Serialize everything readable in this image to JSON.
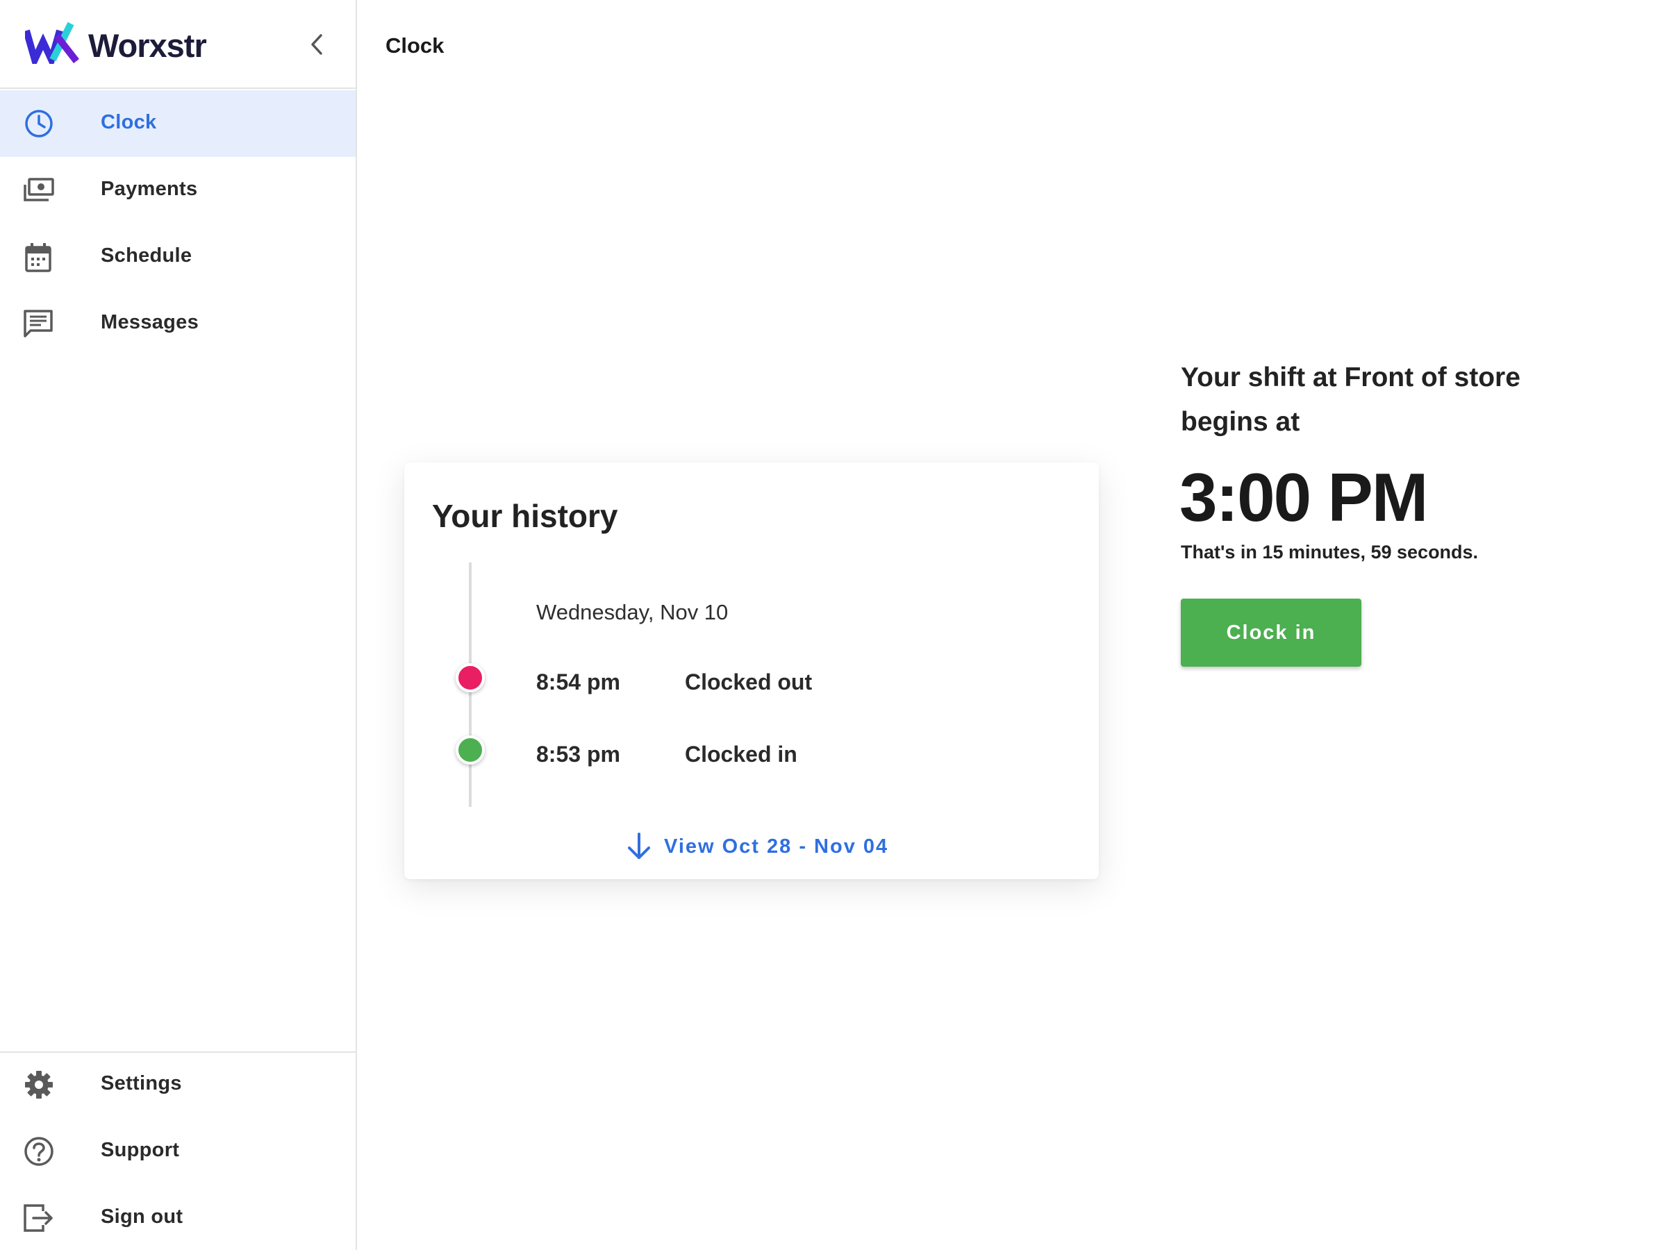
{
  "app": {
    "name": "Worxstr"
  },
  "sidebar": {
    "items": [
      {
        "label": "Clock",
        "icon": "clock-icon",
        "active": true
      },
      {
        "label": "Payments",
        "icon": "payments-icon",
        "active": false
      },
      {
        "label": "Schedule",
        "icon": "calendar-icon",
        "active": false
      },
      {
        "label": "Messages",
        "icon": "message-icon",
        "active": false
      }
    ],
    "bottom_items": [
      {
        "label": "Settings",
        "icon": "gear-icon"
      },
      {
        "label": "Support",
        "icon": "help-icon"
      },
      {
        "label": "Sign out",
        "icon": "sign-out-icon"
      }
    ]
  },
  "header": {
    "title": "Clock"
  },
  "history": {
    "title": "Your history",
    "day": "Wednesday, Nov 10",
    "entries": [
      {
        "time": "8:54 pm",
        "action": "Clocked out",
        "status_color": "#e91e63"
      },
      {
        "time": "8:53 pm",
        "action": "Clocked in",
        "status_color": "#4caf50"
      }
    ],
    "view_more_label": "View Oct 28 - Nov 04"
  },
  "shift": {
    "heading_line1": "Your shift at Front of store",
    "heading_line2": "begins at",
    "time": "3:00 PM",
    "countdown": "That's in 15 minutes, 59 seconds.",
    "clock_in_label": "Clock in"
  },
  "colors": {
    "accent": "#2f6fe0",
    "active_bg": "#e6eefd",
    "clock_in_green": "#4caf50",
    "clocked_out_pink": "#e91e63"
  }
}
